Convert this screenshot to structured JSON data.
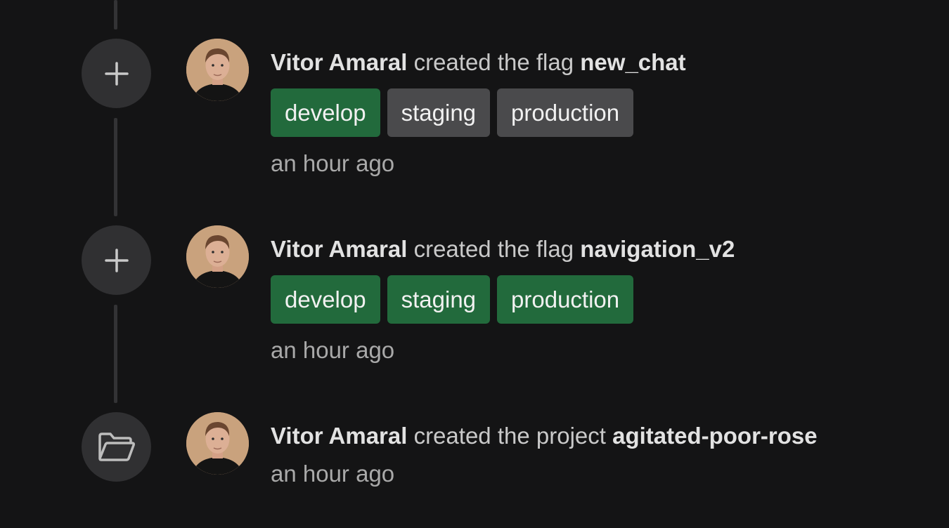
{
  "events": [
    {
      "icon": "plus-icon",
      "actor": "Vitor Amaral",
      "verb": "created the flag",
      "target": "new_chat",
      "environments": [
        {
          "label": "develop",
          "enabled": true
        },
        {
          "label": "staging",
          "enabled": false
        },
        {
          "label": "production",
          "enabled": false
        }
      ],
      "time": "an hour ago"
    },
    {
      "icon": "plus-icon",
      "actor": "Vitor Amaral",
      "verb": "created the flag",
      "target": "navigation_v2",
      "environments": [
        {
          "label": "develop",
          "enabled": true
        },
        {
          "label": "staging",
          "enabled": true
        },
        {
          "label": "production",
          "enabled": true
        }
      ],
      "time": "an hour ago"
    },
    {
      "icon": "folder-open-icon",
      "actor": "Vitor Amaral",
      "verb": "created the project",
      "target": "agitated-poor-rose",
      "time": "an hour ago"
    }
  ],
  "colors": {
    "background": "#141415",
    "icon_circle": "#303032",
    "env_enabled": "#226a3c",
    "env_disabled": "#4a4a4c"
  }
}
